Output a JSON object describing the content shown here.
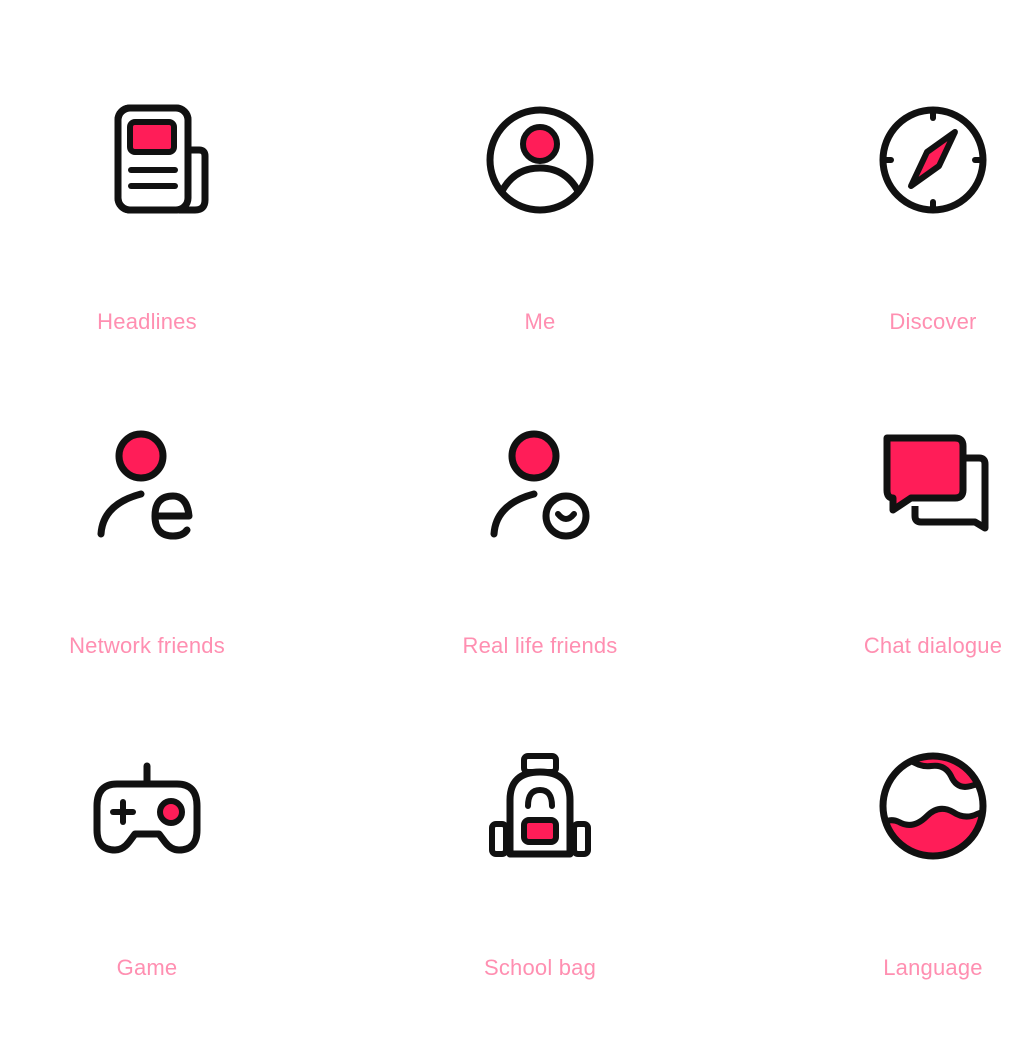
{
  "colors": {
    "accent": "#ff1d58",
    "stroke": "#111111",
    "label": "#ff8fb1"
  },
  "icons": [
    {
      "name": "headlines",
      "icon": "newspaper-icon",
      "label": "Headlines"
    },
    {
      "name": "me",
      "icon": "user-circle-icon",
      "label": "Me"
    },
    {
      "name": "discover",
      "icon": "compass-icon",
      "label": "Discover"
    },
    {
      "name": "network-friends",
      "icon": "network-friend-icon",
      "label": "Network friends"
    },
    {
      "name": "real-life-friends",
      "icon": "real-friend-icon",
      "label": "Real life friends"
    },
    {
      "name": "chat-dialogue",
      "icon": "chat-bubbles-icon",
      "label": "Chat dialogue"
    },
    {
      "name": "game",
      "icon": "gamepad-icon",
      "label": "Game"
    },
    {
      "name": "school-bag",
      "icon": "backpack-icon",
      "label": "School bag"
    },
    {
      "name": "language",
      "icon": "globe-icon",
      "label": "Language"
    }
  ]
}
